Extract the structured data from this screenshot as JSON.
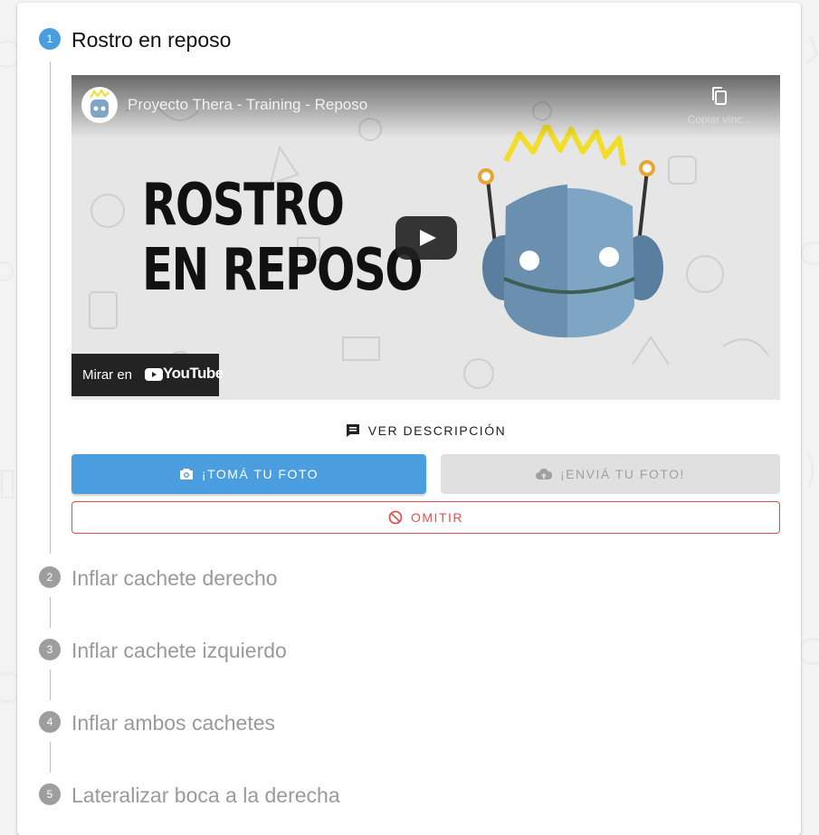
{
  "steps": [
    {
      "number": "1",
      "title": "Rostro en reposo",
      "state": "active"
    },
    {
      "number": "2",
      "title": "Inflar cachete derecho",
      "state": "inactive"
    },
    {
      "number": "3",
      "title": "Inflar cachete izquierdo",
      "state": "inactive"
    },
    {
      "number": "4",
      "title": "Inflar ambos cachetes",
      "state": "inactive"
    },
    {
      "number": "5",
      "title": "Lateralizar boca a la derecha",
      "state": "inactive"
    }
  ],
  "video": {
    "title": "Proyecto Thera - Training - Reposo",
    "copy_link_label": "Copiar vínc...",
    "thumbnail_line1": "ROSTRO",
    "thumbnail_line2": "EN REPOSO",
    "watch_on_label": "Mirar en",
    "youtube_label": "YouTube"
  },
  "actions": {
    "description_label": "VER DESCRIPCIÓN",
    "take_photo_label": "¡TOMÁ TU FOTO",
    "send_photo_label": "¡ENVIÁ TU FOTO!",
    "skip_label": "OMITIR"
  },
  "colors": {
    "primary": "#4a9ee0",
    "danger": "#e05252",
    "disabled_bg": "#e0e0e0",
    "inactive_text": "#9a9a9a"
  },
  "icons": {
    "description": "comment-text-icon",
    "camera": "camera-icon",
    "upload": "cloud-upload-icon",
    "skip": "block-icon",
    "copy": "copy-icon",
    "play": "play-icon"
  }
}
